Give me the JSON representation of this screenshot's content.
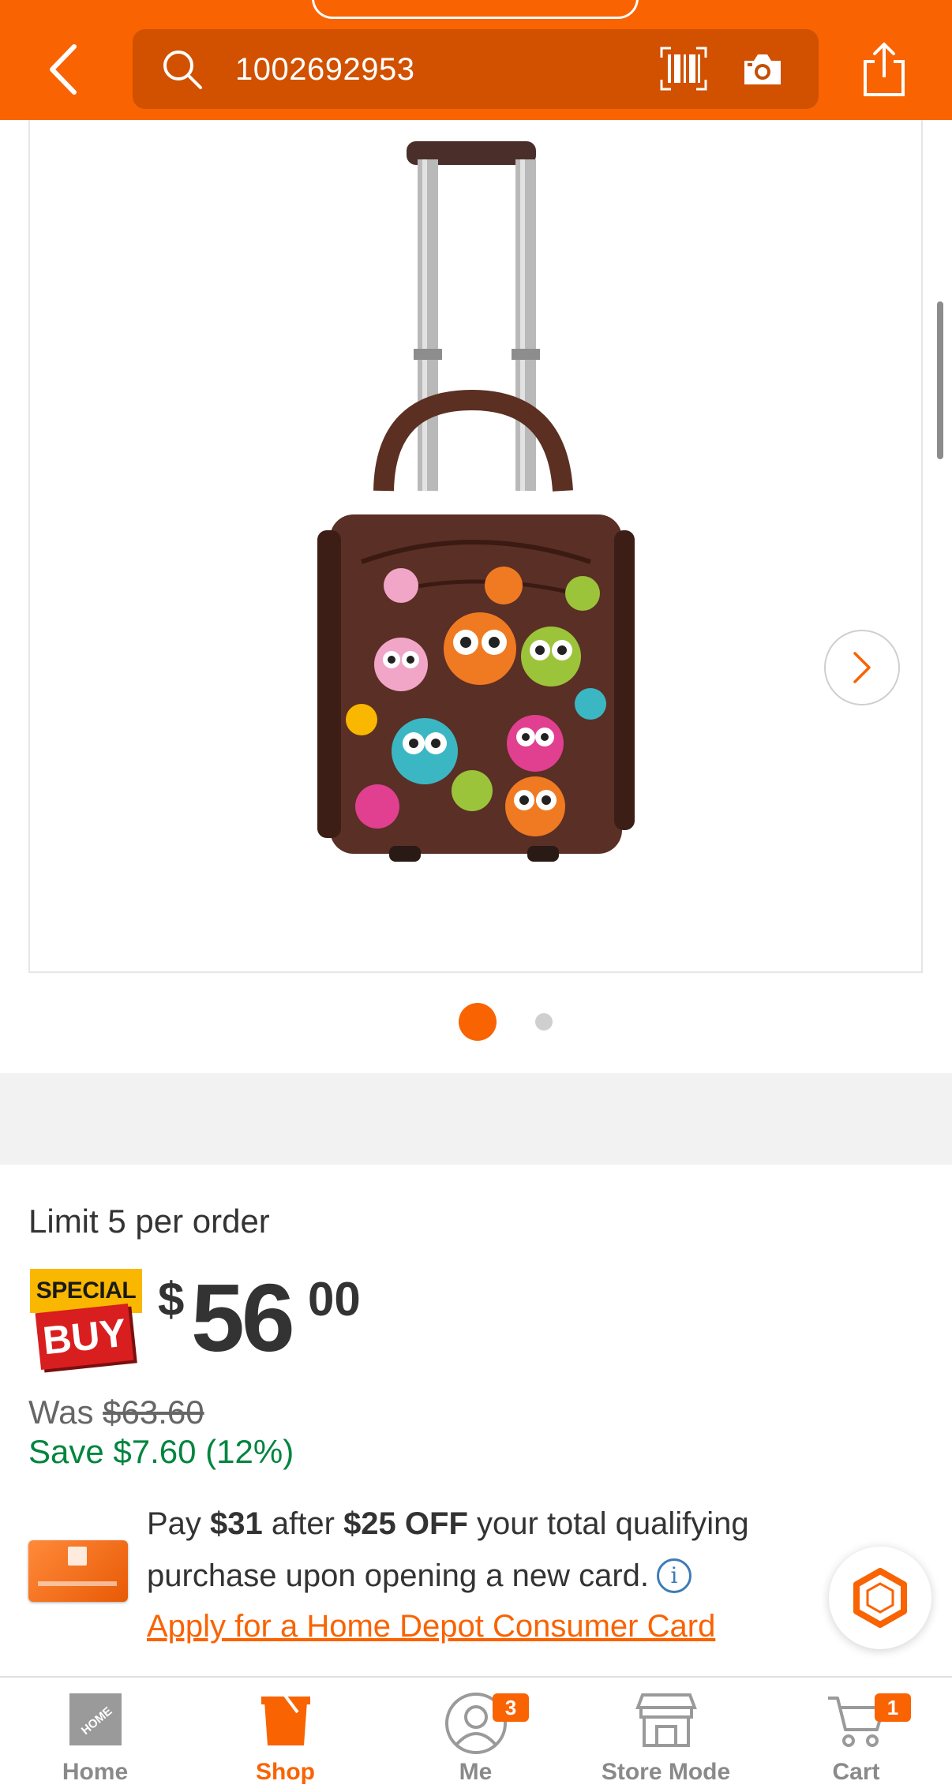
{
  "header": {
    "search_value": "1002692953",
    "back_icon": "chevron-left-icon",
    "search_icon": "search-icon",
    "barcode_icon": "barcode-icon",
    "camera_icon": "camera-icon",
    "share_icon": "share-icon"
  },
  "gallery": {
    "image_description_icon": "product-image",
    "active_slide": 1,
    "slide_count": 2
  },
  "product": {
    "limit_text": "Limit 5 per order",
    "badge_special": "SPECIAL",
    "badge_buy": "BUY",
    "price_dollar_sign": "$",
    "price_whole": "56",
    "price_cents": "00",
    "was_label": "Was ",
    "was_price": "$63.60",
    "save_text": "Save $7.60 (12%)"
  },
  "offer": {
    "line1_a": "Pay ",
    "line1_b": "$31",
    "line1_c": " after ",
    "line1_d": "$25 OFF",
    "line1_e": " your total qualifying",
    "line2": "purchase upon opening a new card.",
    "info_glyph": "i",
    "apply_link": "Apply for a Home Depot Consumer Card"
  },
  "bottom_nav": {
    "items": [
      {
        "label": "Home",
        "icon": "home-depot-logo-icon"
      },
      {
        "label": "Shop",
        "icon": "shop-bucket-icon"
      },
      {
        "label": "Me",
        "icon": "user-icon",
        "badge": "3"
      },
      {
        "label": "Store Mode",
        "icon": "store-icon"
      },
      {
        "label": "Cart",
        "icon": "cart-icon",
        "badge": "1"
      }
    ],
    "active_index": 1
  },
  "colors": {
    "brand_orange": "#f96302",
    "save_green": "#00853f",
    "special_yellow": "#f9b700",
    "buy_red": "#d81e1e"
  }
}
